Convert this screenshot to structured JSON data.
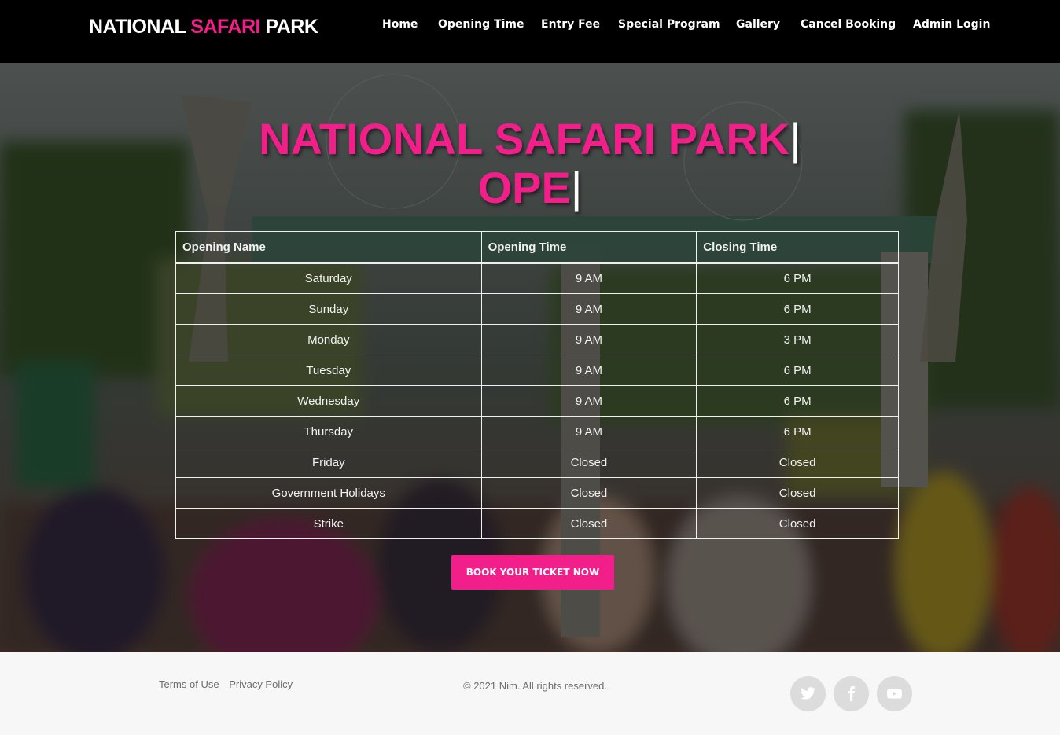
{
  "navbar": {
    "brand_part1": "NATIONAL ",
    "brand_accent": "SAFARI",
    "brand_part2": " PARK",
    "links": [
      {
        "label": "Home"
      },
      {
        "label": "Opening Time"
      },
      {
        "label": "Entry Fee"
      },
      {
        "label": "Special Program"
      },
      {
        "label": "Gallery"
      },
      {
        "label": "Cancel Booking"
      },
      {
        "label": "Admin Login"
      }
    ]
  },
  "hero": {
    "title_line1": "NATIONAL SAFARI PARK",
    "title_line2": "OPE",
    "cursor": "|"
  },
  "hours_table": {
    "headers": [
      "Opening Name",
      "Opening Time",
      "Closing Time"
    ],
    "rows": [
      {
        "day": "Saturday",
        "open": "9 AM",
        "close": "6 PM"
      },
      {
        "day": "Sunday",
        "open": "9 AM",
        "close": "6 PM"
      },
      {
        "day": "Monday",
        "open": "9 AM",
        "close": "3 PM"
      },
      {
        "day": "Tuesday",
        "open": "9 AM",
        "close": "6 PM"
      },
      {
        "day": "Wednesday",
        "open": "9 AM",
        "close": "6 PM"
      },
      {
        "day": "Thursday",
        "open": "9 AM",
        "close": "6 PM"
      },
      {
        "day": "Friday",
        "open": "Closed",
        "close": "Closed"
      },
      {
        "day": "Government Holidays",
        "open": "Closed",
        "close": "Closed"
      },
      {
        "day": "Strike",
        "open": "Closed",
        "close": "Closed"
      }
    ]
  },
  "book_button": {
    "label": "BOOK YOUR TICKET NOW"
  },
  "footer": {
    "links": [
      "Terms of Use",
      "Privacy Policy"
    ],
    "copyright": "© 2021 Nim. All rights reserved.",
    "social": [
      {
        "icon": "twitter-icon"
      },
      {
        "icon": "facebook-icon"
      },
      {
        "icon": "youtube-icon"
      }
    ]
  },
  "colors": {
    "accent": "#f21f8b",
    "navbar_bg": "#000000",
    "footer_bg": "#f7f7f7"
  }
}
